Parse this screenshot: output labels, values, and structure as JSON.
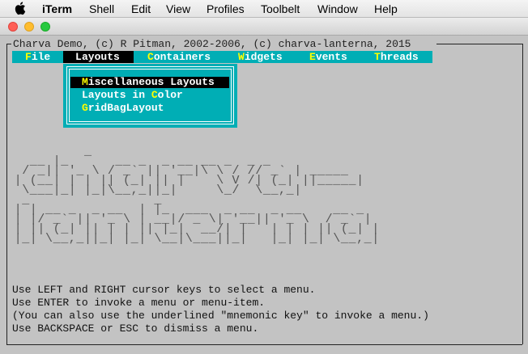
{
  "macos_menubar": {
    "apple_icon": "apple-logo-icon",
    "app_name": "iTerm",
    "items": [
      "Shell",
      "Edit",
      "View",
      "Profiles",
      "Toolbelt",
      "Window",
      "Help"
    ]
  },
  "window": {
    "traffic_lights": {
      "close": "#ff5f56",
      "minimize": "#ffbd2e",
      "zoom": "#27c93f"
    }
  },
  "terminal": {
    "frame_title": "Charva Demo, (c) R Pitman, 2002-2006, (c) charva-lanterna, 2015",
    "menubar": {
      "items": [
        {
          "mnemonic": "F",
          "rest": "ile"
        },
        {
          "mnemonic": "L",
          "rest": "ayouts"
        },
        {
          "mnemonic": "C",
          "rest": "ontainers"
        },
        {
          "mnemonic": "W",
          "rest": "idgets"
        },
        {
          "mnemonic": "E",
          "rest": "vents"
        },
        {
          "mnemonic": "T",
          "rest": "hreads"
        }
      ],
      "selected_index": 1
    },
    "dropdown": {
      "items": [
        {
          "pre": "",
          "mnemonic": "M",
          "rest": "iscellaneous Layouts"
        },
        {
          "pre": "Layouts in ",
          "mnemonic": "C",
          "rest": "olor"
        },
        {
          "pre": "",
          "mnemonic": "G",
          "rest": "ridBagLayout"
        }
      ],
      "selected_index": 0
    },
    "ascii_art": "          _\n   __ |_      __ _  _ __ __ _  _ _\n  / _|| '_ \\ / _` || '__|\\ \\ / // _` | _____\n | (__| | | || (_| || |    \\ V /| (_| ||_____|\n  \\___|_| |_|\\__,_||_|     \\_/  \\__,_|\n  _                _\n | | __ _  _ __  | |_  ___  _ __  _ __    __ _\n | |/ _` || '_ \\ | __|/ _ \\| '__|| '_ \\  / _` |\n | || (_| || | | || |_|  __/| |   | | | || (_| |\n |_| \\__,_||_| |_| \\__|\\___||_|   |_| |_| \\__,_|",
    "help_lines": [
      "Use LEFT and RIGHT cursor keys to select a menu.",
      "Use ENTER to invoke a menu or menu-item.",
      "(You can also use the underlined \"mnemonic key\" to invoke a menu.)",
      "Use BACKSPACE or ESC to dismiss a menu."
    ],
    "colors": {
      "menu_bg": "#00aeb5",
      "mnemonic": "#ffff00",
      "menu_text": "#ffffff",
      "selection_bg": "#000000",
      "screen_bg": "#c3c3c3"
    }
  }
}
